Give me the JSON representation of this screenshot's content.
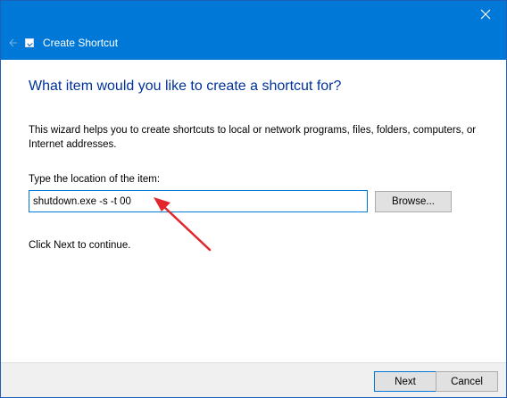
{
  "window": {
    "title": "Create Shortcut",
    "title_bar_color": "#0078d7",
    "close_icon": "close-icon",
    "back_icon": "back-arrow-icon",
    "app_icon": "shortcut-icon"
  },
  "content": {
    "heading": "What item would you like to create a shortcut for?",
    "intro": "This wizard helps you to create shortcuts to local or network programs, files, folders, computers, or Internet addresses.",
    "location_label": "Type the location of the item:",
    "location_value": "shutdown.exe -s -t 00",
    "browse_label": "Browse...",
    "hint": "Click Next to continue."
  },
  "footer": {
    "next_label": "Next",
    "cancel_label": "Cancel"
  },
  "annotation": {
    "arrow_color": "#e3262b"
  }
}
